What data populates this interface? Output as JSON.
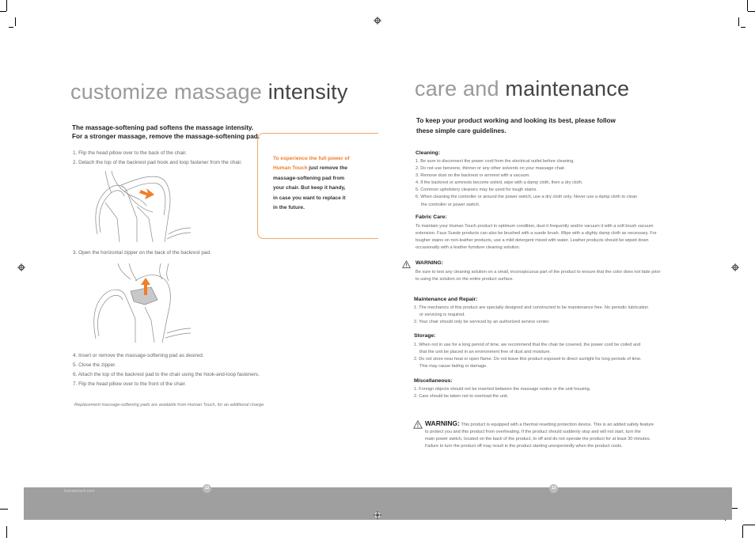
{
  "left_page": {
    "title_light": "customize massage",
    "title_dark": "intensity",
    "intro_line1": "The massage-softening pad softens the massage intensity.",
    "intro_line2": "For a stronger massage, remove the massage-softening pad.",
    "steps": [
      "1.  Flip the head pillow over to the back of the chair.",
      "2.  Detach the top of the backrest pad hook and loop fastener from the chair.",
      "3.  Open the horizontal zipper on the back of the backrest pad.",
      "4.  Insert or remove the massage-softening pad as desired.",
      "5.  Close the zipper.",
      "6.  Attach the top of the backrest pad to the chair using the hook-and-loop fasteners.",
      "7.  Flip the head pillow over to the front of the chair."
    ],
    "callout": {
      "highlight_line1": "To experience the full power of",
      "highlight_line2": "Human Touch",
      "rest_line2": " just remove the",
      "line3": "massage-softening pad from",
      "line4": "your chair. But keep it handy,",
      "line5": "in case you want to replace it",
      "line6": "in the future."
    },
    "footnote": "Replacement massage-softening pads are available from Human Touch, for an additional charge.",
    "illustration_1": "chair-detach-backrest-pad",
    "illustration_2": "chair-remove-softening-pad",
    "footer_url": "humantouch.com",
    "page_number": "12"
  },
  "right_page": {
    "title_light": "care and",
    "title_dark": "maintenance",
    "intro_line1": "To keep your product working and looking its best, please follow",
    "intro_line2": "these simple care guidelines.",
    "cleaning": {
      "heading": "Cleaning:",
      "items": [
        "1. Be sure to disconnect the power cord from the electrical outlet before cleaning.",
        "2. Do not use benzene, thinner or any other solvents on your massage chair.",
        "3. Remove dust on the backrest or armrest with a vacuum.",
        "4. If the backrest or armrests become soiled, wipe with a damp cloth, then a dry cloth.",
        "5. Common upholstery cleaners may be used for tough stains.",
        "6. When cleaning the controller or around the power switch, use a dry cloth only. Never use a damp cloth to clean"
      ],
      "item6_cont": "the controller or power switch."
    },
    "fabric_care": {
      "heading": "Fabric Care:",
      "line1": "To maintain your Human Touch product in optimum condition, dust it frequently and/or vacuum it with a soft brush vacuum",
      "line2": "extension. Faux Suede products can also be brushed with a suede brush. Wipe with a slighty damp cloth as necessary. For",
      "line3": "tougher stains on non-leather products, use a mild detergent mixed with water. Leather products should be wiped down",
      "line4": "occasionally with a leather furniture cleaning solution."
    },
    "warning1": {
      "heading": "WARNING:",
      "line1": "Be sure to test any cleaning solution on a small, inconspicuous part of the product to ensure that the color does not fade prior",
      "line2": "to using the solution on the entire product surface."
    },
    "maintenance": {
      "heading": "Maintenance and Repair:",
      "item1": "1. The mechanics of this product are specially designed and constructed to be maintenance free. No periodic lubrication",
      "item1_cont": "or servicing is required.",
      "item2": "2. Your chair should only be serviced by an authorized service center."
    },
    "storage": {
      "heading": "Storage:",
      "item1": "1. When not in use for a long period of time, we recommend that the chair be covered, the power cord be coiled and",
      "item1_cont": "that the unit be placed in an environment free of dust and moisture.",
      "item2": "2. Do not store near heat or open flame. Do not leave this product exposed to direct sunlight for long periods of time.",
      "item2_cont": "This may cause fading or damage."
    },
    "misc": {
      "heading": "Miscellaneous:",
      "item1": "1. Foreign objects should not be inserted between the massage nodes or the unit housing.",
      "item2": "2. Care should be taken not to overload the unit."
    },
    "warning2": {
      "heading": "WARNING:",
      "line1": " This product is equipped with a thermal resetting protection device. This is an added safety feature",
      "line2": "to protect you and this product from overheating. If the product should suddenly stop and will not start, turn the",
      "line3": "main power switch, located on the back of the product, to off and do not operate the product for at least 30 minutes.",
      "line4": "Failure to turn the product off may result in the product starting unexpectedly when the product cools."
    },
    "page_number": "13"
  },
  "colors": {
    "accent_orange": "#f07d2a",
    "footer_gray": "#9f9f9f",
    "title_light": "#9a9a9a",
    "title_dark": "#444444"
  }
}
